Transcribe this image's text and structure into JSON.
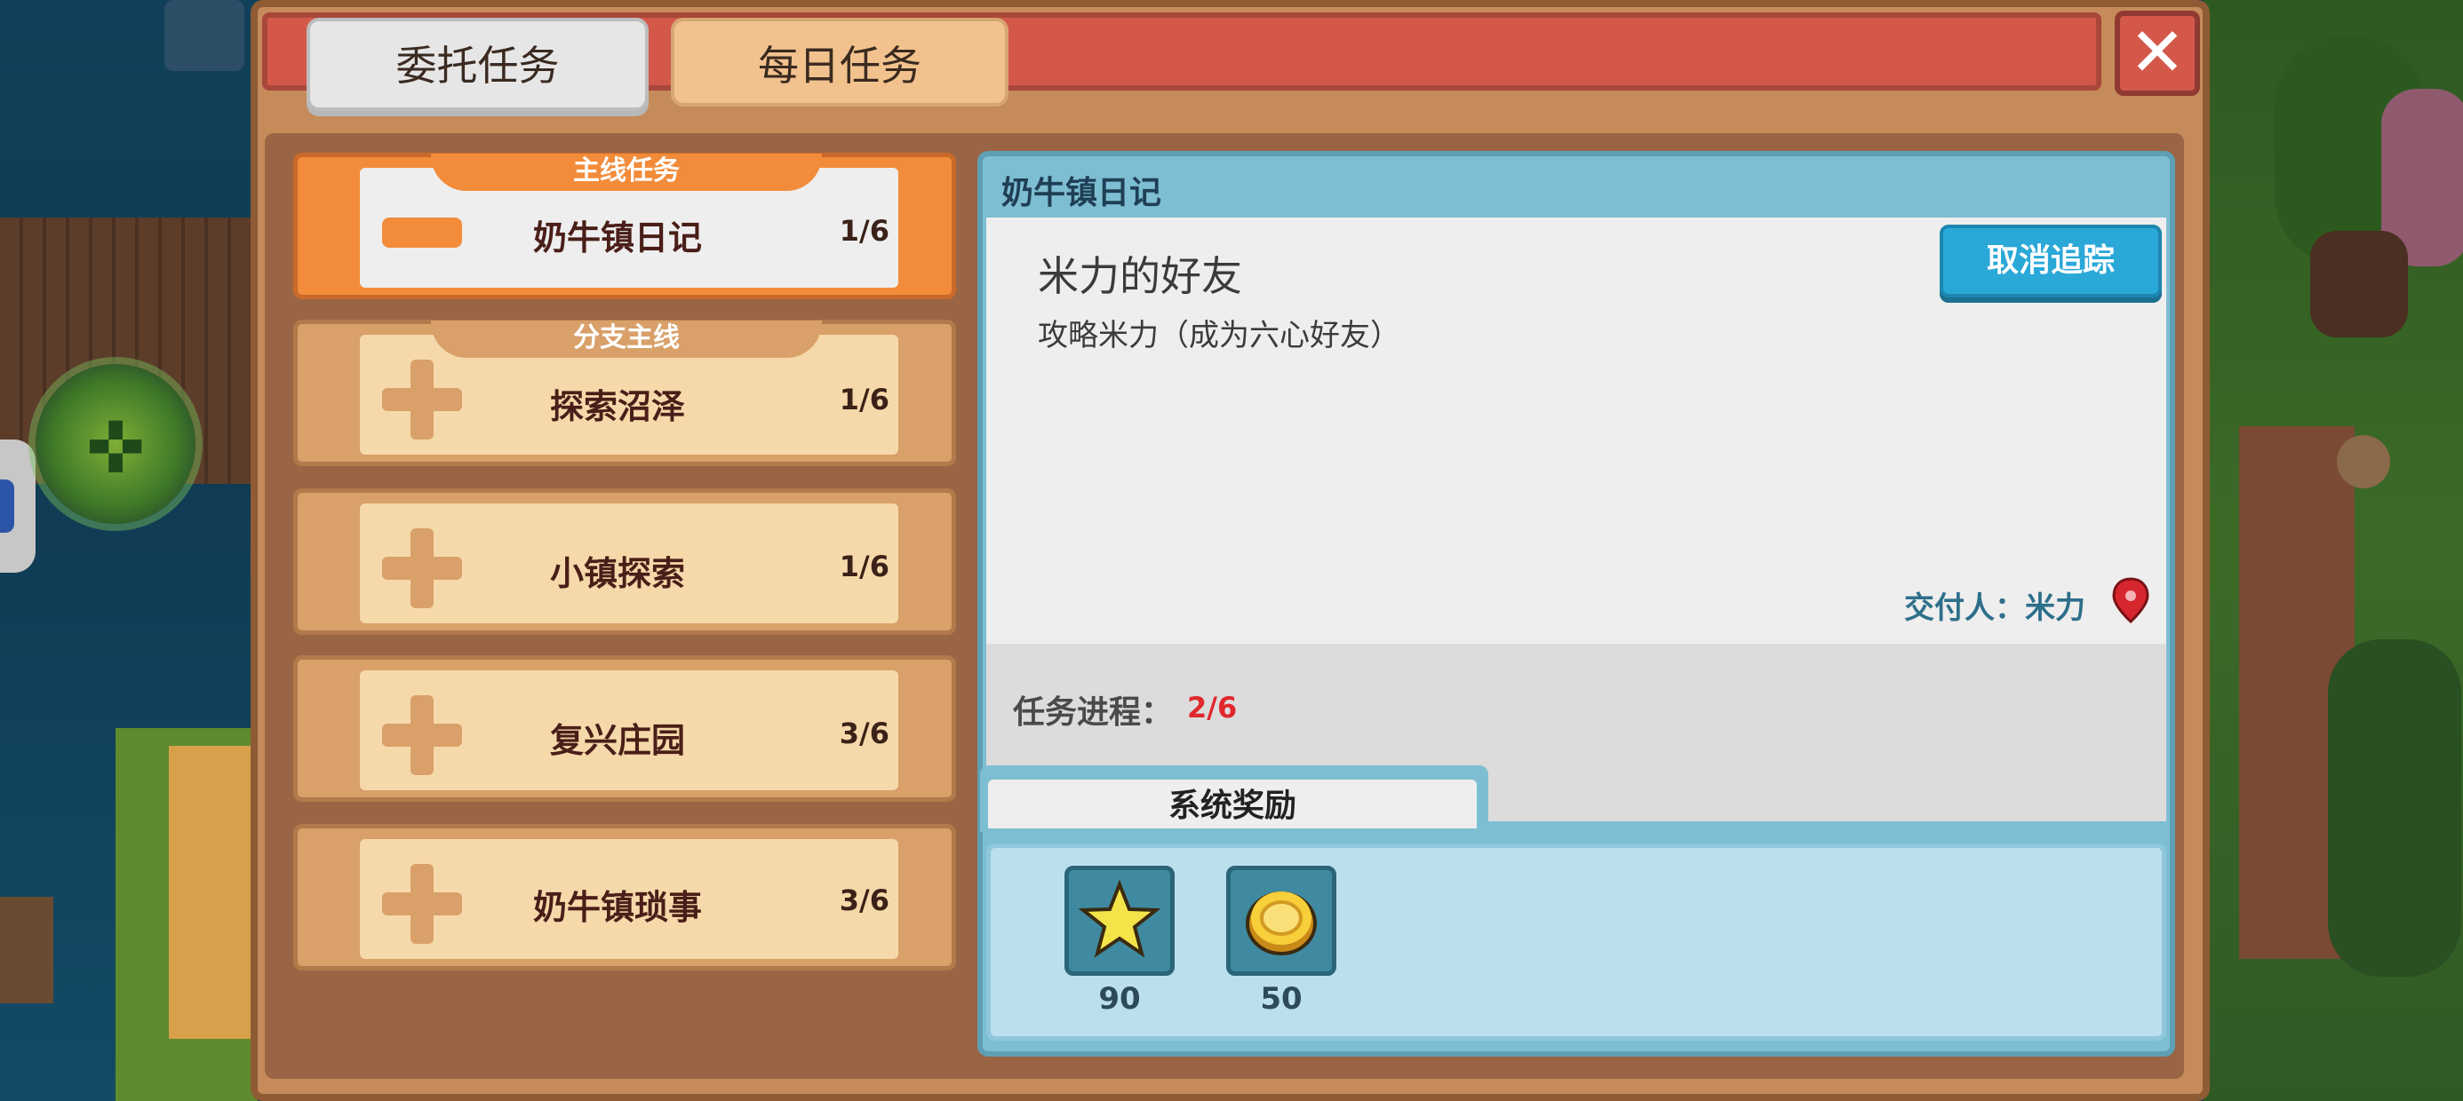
{
  "tabs": {
    "commission": "委托任务",
    "daily": "每日任务"
  },
  "close_icon": "close-icon",
  "quest_list": [
    {
      "header": "主线任务",
      "name": "奶牛镇日记",
      "count": "1/6",
      "state": "expanded"
    },
    {
      "header": "分支主线",
      "name": "探索沼泽",
      "count": "1/6",
      "state": "collapsed"
    },
    {
      "header": "",
      "name": "小镇探索",
      "count": "1/6",
      "state": "collapsed"
    },
    {
      "header": "",
      "name": "复兴庄园",
      "count": "3/6",
      "state": "collapsed"
    },
    {
      "header": "",
      "name": "奶牛镇琐事",
      "count": "3/6",
      "state": "collapsed"
    }
  ],
  "detail": {
    "chapter_title": "奶牛镇日记",
    "quest_title": "米力的好友",
    "quest_desc": "攻略米力（成为六心好友）",
    "untrack_button": "取消追踪",
    "giver": "交付人：米力",
    "giver_icon": "map-pin-icon",
    "progress_label": "任务进程：",
    "progress_value": "2/6",
    "reward_tab": "系统奖励",
    "rewards": [
      {
        "icon": "star-icon",
        "amount": "90"
      },
      {
        "icon": "gold-coin-icon",
        "amount": "50"
      }
    ]
  },
  "colors": {
    "title_band": "#d4584a",
    "active_item": "#f28c3a",
    "untrack_button": "#2aa8d8",
    "progress_value": "#e0282c"
  }
}
